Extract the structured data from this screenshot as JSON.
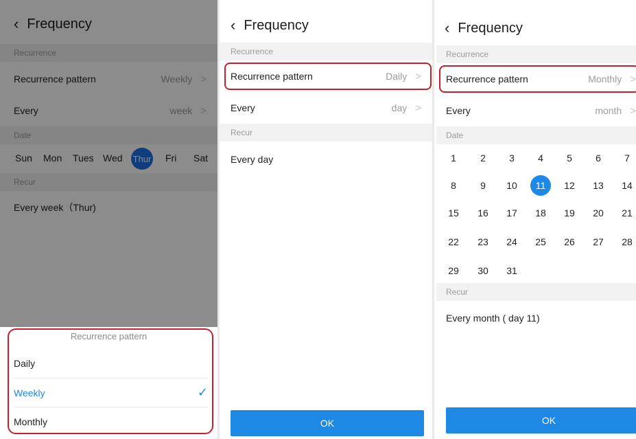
{
  "screens": [
    {
      "header": {
        "back_icon": "‹",
        "title": "Frequency"
      },
      "section_recurrence": "Recurrence",
      "pattern_row": {
        "label": "Recurrence pattern",
        "value": "Weekly",
        "chevron": ">"
      },
      "every_row": {
        "label": "Every",
        "value": "week",
        "chevron": ">"
      },
      "section_date": "Date",
      "weekdays": [
        "Sun",
        "Mon",
        "Tues",
        "Wed",
        "Thur",
        "Fri",
        "Sat"
      ],
      "selected_weekday": "Thur",
      "section_recur": "Recur",
      "recur_text": "Every week（Thur)",
      "sheet": {
        "title": "Recurrence pattern",
        "options": [
          "Daily",
          "Weekly",
          "Monthly"
        ],
        "selected": "Weekly",
        "check_icon": "✓"
      }
    },
    {
      "header": {
        "back_icon": "‹",
        "title": "Frequency"
      },
      "section_recurrence": "Recurrence",
      "pattern_row": {
        "label": "Recurrence pattern",
        "value": "Daily",
        "chevron": ">"
      },
      "every_row": {
        "label": "Every",
        "value": "day",
        "chevron": ">"
      },
      "section_recur": "Recur",
      "recur_text": "Every day",
      "ok_label": "OK"
    },
    {
      "header": {
        "back_icon": "‹",
        "title": "Frequency"
      },
      "section_recurrence": "Recurrence",
      "pattern_row": {
        "label": "Recurrence pattern",
        "value": "Monthly",
        "chevron": ">"
      },
      "every_row": {
        "label": "Every",
        "value": "month",
        "chevron": ">"
      },
      "section_date": "Date",
      "days": [
        "1",
        "2",
        "3",
        "4",
        "5",
        "6",
        "7",
        "8",
        "9",
        "10",
        "11",
        "12",
        "13",
        "14",
        "15",
        "16",
        "17",
        "18",
        "19",
        "20",
        "21",
        "22",
        "23",
        "24",
        "25",
        "26",
        "27",
        "28",
        "29",
        "30",
        "31"
      ],
      "selected_day": "11",
      "section_recur": "Recur",
      "recur_text": "Every month ( day 11)",
      "ok_label": "OK"
    }
  ],
  "colors": {
    "accent": "#1e88e5",
    "highlight_border": "#c41f2a",
    "section_bg": "#f2f2f2",
    "muted_text": "#9b9b9b"
  }
}
